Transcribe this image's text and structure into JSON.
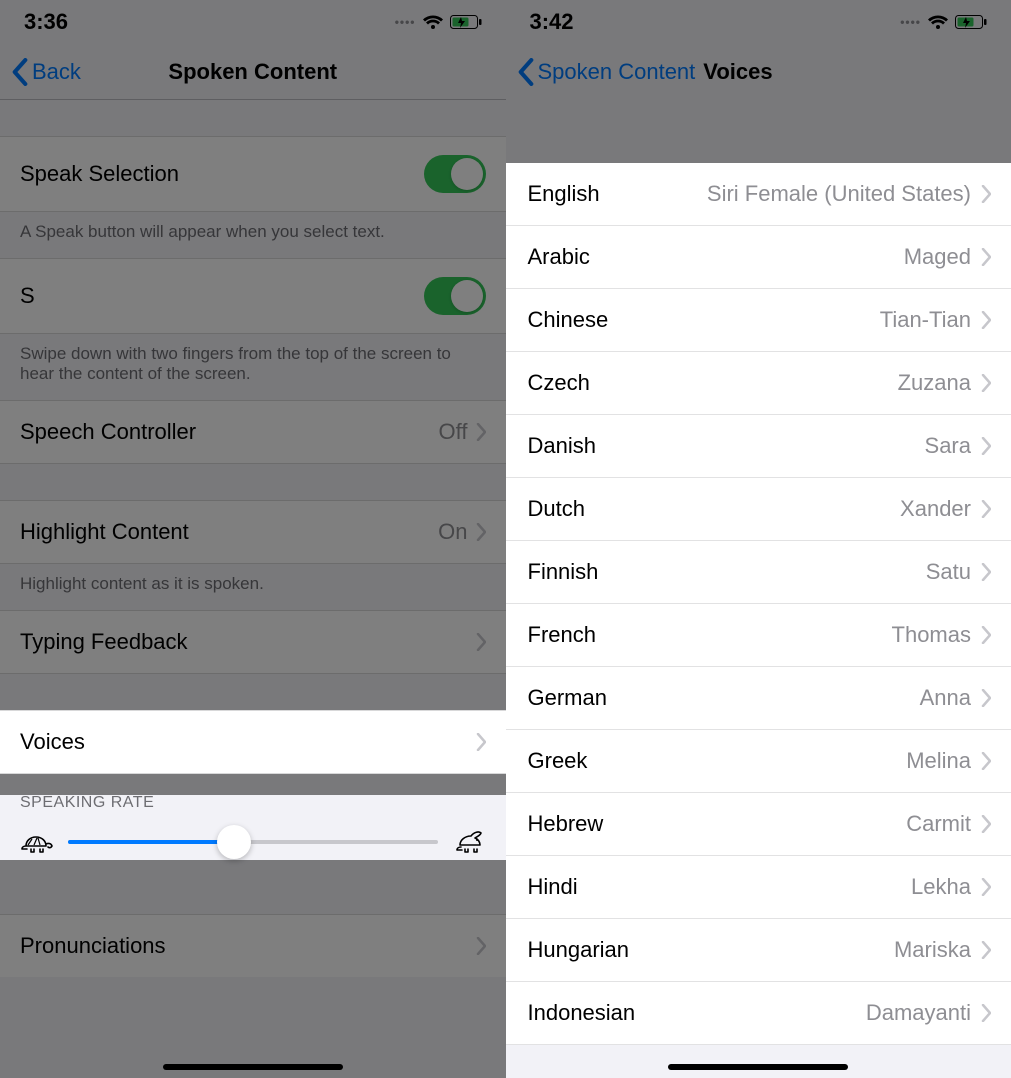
{
  "left": {
    "status": {
      "time": "3:36"
    },
    "nav": {
      "back": "Back",
      "title": "Spoken Content"
    },
    "speakSelection": {
      "label": "Speak Selection",
      "footer": "A Speak button will appear when you select text."
    },
    "speakScreen": {
      "label": "S",
      "footer": "Swipe down with two fingers from the top of the screen to hear the content of the screen."
    },
    "speechController": {
      "label": "Speech Controller",
      "value": "Off"
    },
    "highlight": {
      "label": "Highlight Content",
      "value": "On",
      "footer": "Highlight content as it is spoken."
    },
    "typing": {
      "label": "Typing Feedback"
    },
    "voices": {
      "label": "Voices"
    },
    "rateHeader": "SPEAKING RATE",
    "pronunciations": "Pronunciations"
  },
  "right": {
    "status": {
      "time": "3:42"
    },
    "nav": {
      "back": "Spoken Content",
      "title": "Voices"
    },
    "voices": [
      {
        "lang": "English",
        "voice": "Siri Female (United States)"
      },
      {
        "lang": "Arabic",
        "voice": "Maged"
      },
      {
        "lang": "Chinese",
        "voice": "Tian-Tian"
      },
      {
        "lang": "Czech",
        "voice": "Zuzana"
      },
      {
        "lang": "Danish",
        "voice": "Sara"
      },
      {
        "lang": "Dutch",
        "voice": "Xander"
      },
      {
        "lang": "Finnish",
        "voice": "Satu"
      },
      {
        "lang": "French",
        "voice": "Thomas"
      },
      {
        "lang": "German",
        "voice": "Anna"
      },
      {
        "lang": "Greek",
        "voice": "Melina"
      },
      {
        "lang": "Hebrew",
        "voice": "Carmit"
      },
      {
        "lang": "Hindi",
        "voice": "Lekha"
      },
      {
        "lang": "Hungarian",
        "voice": "Mariska"
      },
      {
        "lang": "Indonesian",
        "voice": "Damayanti"
      }
    ]
  },
  "colors": {
    "accent": "#007aff",
    "toggleOn": "#34c759",
    "secondary": "#8e8e93"
  }
}
